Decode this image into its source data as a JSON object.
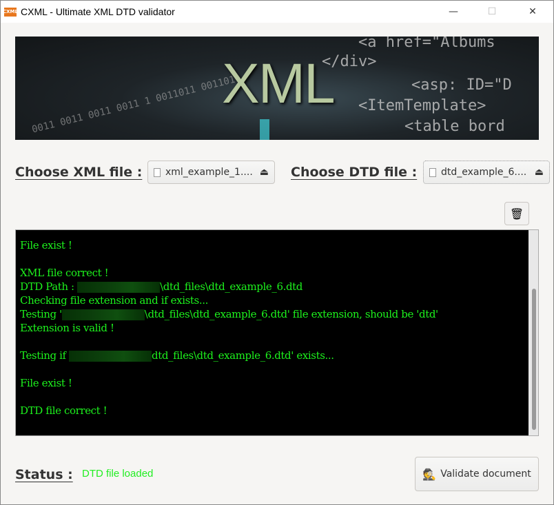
{
  "window": {
    "title": "CXML - Ultimate XML DTD validator",
    "icon_text": "CXML",
    "minimize": "—",
    "maximize": "☐",
    "close": "✕"
  },
  "banner": {
    "big_text": "XML",
    "code_lines": [
      "<a href=\"Albums",
      "</div>",
      "<asp: ID=\"D",
      "<ItemTemplate>",
      "<table bord"
    ],
    "binary": "0011 0011 0011 0011\n1 0011011 0011011"
  },
  "xml_chooser": {
    "label": "Choose XML file :",
    "file": "xml_example_1....",
    "icon": "file-icon"
  },
  "dtd_chooser": {
    "label": "Choose DTD file :",
    "file": "dtd_example_6....",
    "icon": "file-icon"
  },
  "clear_button": {
    "icon": "trash-icon",
    "glyph": "🗑"
  },
  "console": {
    "lines": [
      {
        "text": "File exist !"
      },
      {
        "text": ""
      },
      {
        "text": "XML file correct !"
      },
      {
        "pre": "DTD Path : ",
        "redacted": true,
        "text": "\\dtd_files\\dtd_example_6.dtd"
      },
      {
        "text": "Checking file extension and if exists..."
      },
      {
        "pre": "Testing '",
        "redacted": true,
        "text": "\\dtd_files\\dtd_example_6.dtd' file extension, should be 'dtd'"
      },
      {
        "text": "Extension is valid !"
      },
      {
        "text": ""
      },
      {
        "pre": "Testing if ",
        "redacted": true,
        "text": "dtd_files\\dtd_example_6.dtd' exists..."
      },
      {
        "text": ""
      },
      {
        "text": "File exist !"
      },
      {
        "text": ""
      },
      {
        "text": "DTD file correct !"
      }
    ],
    "text_color": "#1df21d",
    "background": "#000000"
  },
  "status": {
    "label": "Status :",
    "value": "DTD file loaded",
    "color": "#22ee22"
  },
  "validate_button": {
    "label": "Validate document",
    "icon": "spy-icon"
  }
}
